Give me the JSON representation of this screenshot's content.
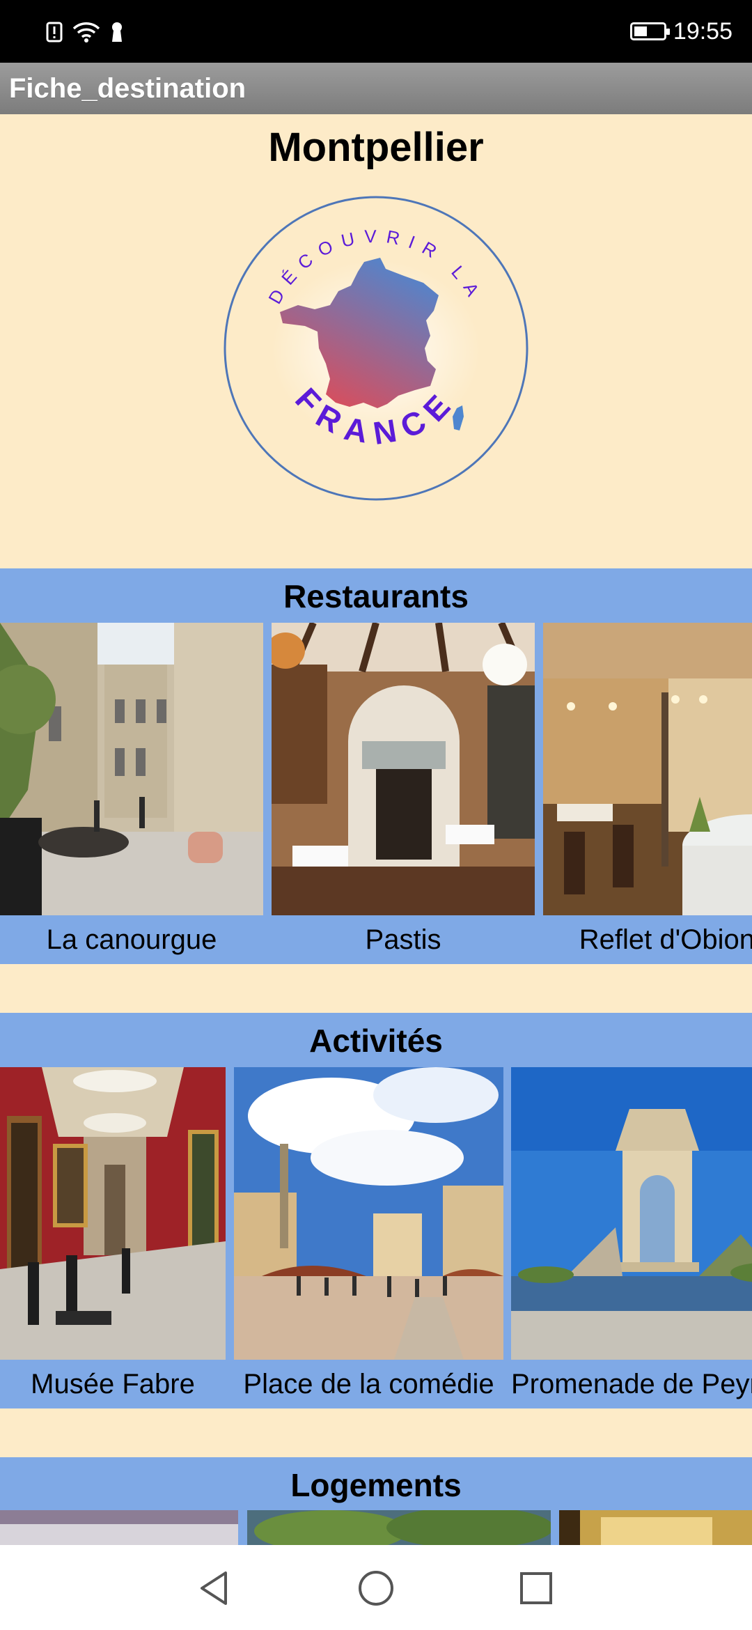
{
  "status_bar": {
    "time": "19:55",
    "icons": [
      "alert-icon",
      "wifi-icon",
      "keyhole-icon",
      "battery-icon"
    ],
    "battery_level": 0.45
  },
  "app_bar": {
    "title": "Fiche_destination"
  },
  "destination": {
    "name": "Montpellier",
    "logo": {
      "top_text": "DÉCOUVRIR LA",
      "bottom_text": "FRANCE"
    }
  },
  "sections": {
    "restaurants": {
      "title": "Restaurants",
      "items": [
        {
          "label": "La canourgue"
        },
        {
          "label": "Pastis"
        },
        {
          "label": "Reflet d'Obione"
        }
      ]
    },
    "activites": {
      "title": "Activités",
      "items": [
        {
          "label": "Musée Fabre"
        },
        {
          "label": "Place de la comédie"
        },
        {
          "label": "Promenade de Peyrou"
        }
      ]
    },
    "logements": {
      "title": "Logements"
    }
  },
  "nav_bar": {
    "icons": [
      "back-icon",
      "home-icon",
      "recents-icon"
    ]
  },
  "colors": {
    "page_background": "#FDEBC8",
    "section_background": "#7FA9E6",
    "logo_outline": "#4E76B8",
    "logo_text": "#5B1BD8",
    "map_gradient_top": "#4E86CF",
    "map_gradient_bottom": "#E24A55"
  }
}
